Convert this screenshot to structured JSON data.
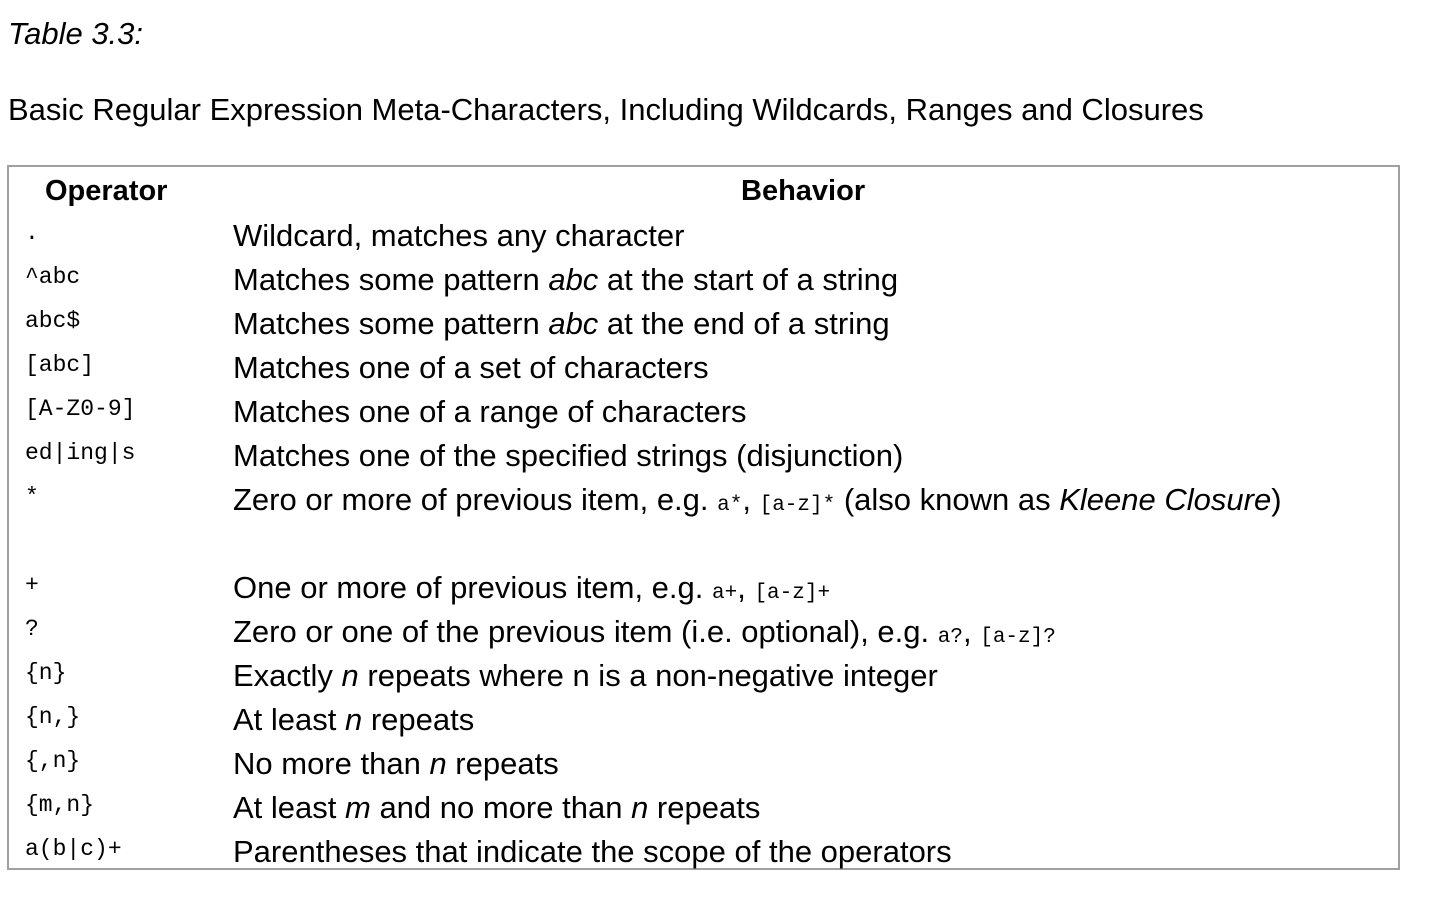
{
  "caption": "Table 3.3:",
  "subtitle": "Basic Regular Expression Meta-Characters, Including Wildcards, Ranges and Closures",
  "table": {
    "headers": {
      "operator": "Operator",
      "behavior": "Behavior"
    },
    "rows": [
      {
        "operator": ".",
        "behavior": [
          {
            "t": "Wildcard, matches any character"
          }
        ]
      },
      {
        "operator": "^abc",
        "behavior": [
          {
            "t": "Matches some pattern "
          },
          {
            "t": "abc",
            "s": "i"
          },
          {
            "t": " at the start of a string"
          }
        ]
      },
      {
        "operator": "abc$",
        "behavior": [
          {
            "t": "Matches some pattern "
          },
          {
            "t": "abc",
            "s": "i"
          },
          {
            "t": " at the end of a string"
          }
        ]
      },
      {
        "operator": "[abc]",
        "behavior": [
          {
            "t": "Matches one of a set of characters"
          }
        ]
      },
      {
        "operator": "[A-Z0-9]",
        "behavior": [
          {
            "t": "Matches one of a range of characters"
          }
        ]
      },
      {
        "operator": "ed|ing|s",
        "behavior": [
          {
            "t": "Matches one of the specified strings (disjunction)"
          }
        ]
      },
      {
        "operator": "*",
        "tall": true,
        "behavior": [
          {
            "t": "Zero or more of previous item, e.g. "
          },
          {
            "t": "a*",
            "s": "m"
          },
          {
            "t": ", "
          },
          {
            "t": "[a-z]*",
            "s": "m"
          },
          {
            "t": " (also known as "
          },
          {
            "t": "Kleene Closure",
            "s": "i"
          },
          {
            "t": ")"
          }
        ]
      },
      {
        "operator": "+",
        "behavior": [
          {
            "t": "One or more of previous item, e.g. "
          },
          {
            "t": "a+",
            "s": "m"
          },
          {
            "t": ", "
          },
          {
            "t": "[a-z]+",
            "s": "m"
          }
        ]
      },
      {
        "operator": "?",
        "behavior": [
          {
            "t": "Zero or one of the previous item (i.e. optional), e.g. "
          },
          {
            "t": "a?",
            "s": "m"
          },
          {
            "t": ", "
          },
          {
            "t": "[a-z]?",
            "s": "m"
          }
        ]
      },
      {
        "operator": "{n}",
        "behavior": [
          {
            "t": "Exactly "
          },
          {
            "t": "n",
            "s": "i"
          },
          {
            "t": " repeats where n is a non-negative integer"
          }
        ]
      },
      {
        "operator": "{n,}",
        "behavior": [
          {
            "t": "At least "
          },
          {
            "t": "n",
            "s": "i"
          },
          {
            "t": " repeats"
          }
        ]
      },
      {
        "operator": "{,n}",
        "behavior": [
          {
            "t": "No more than "
          },
          {
            "t": "n",
            "s": "i"
          },
          {
            "t": " repeats"
          }
        ]
      },
      {
        "operator": "{m,n}",
        "behavior": [
          {
            "t": "At least "
          },
          {
            "t": "m",
            "s": "i"
          },
          {
            "t": " and no more than "
          },
          {
            "t": "n",
            "s": "i"
          },
          {
            "t": " repeats"
          }
        ]
      },
      {
        "operator": "a(b|c)+",
        "behavior": [
          {
            "t": "Parentheses that indicate the scope of the operators"
          }
        ]
      }
    ]
  }
}
